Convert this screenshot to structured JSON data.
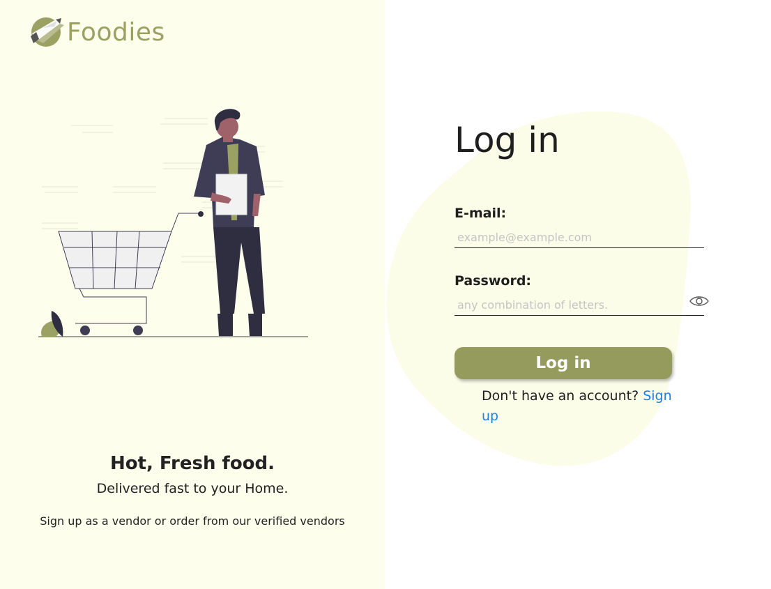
{
  "brand": {
    "name": "Foodies",
    "color": "#9aa162"
  },
  "left": {
    "title": "Hot, Fresh food.",
    "subtitle": "Delivered fast to your Home.",
    "cta": "Sign up as a vendor or order from our verified vendors",
    "background": "#fdfeec"
  },
  "login": {
    "title": "Log in",
    "email": {
      "label": "E-mail:",
      "placeholder": "example@example.com",
      "value": ""
    },
    "password": {
      "label": "Password:",
      "placeholder": "any combination of letters.",
      "value": ""
    },
    "button_label": "Log in",
    "button_color": "#959b5d",
    "signup_prompt": "Don't have an account? ",
    "signup_link": "Sign up",
    "link_color": "#1d7fe0"
  },
  "icons": {
    "logo": "rocket-logo-icon",
    "password_toggle": "eye-icon"
  }
}
